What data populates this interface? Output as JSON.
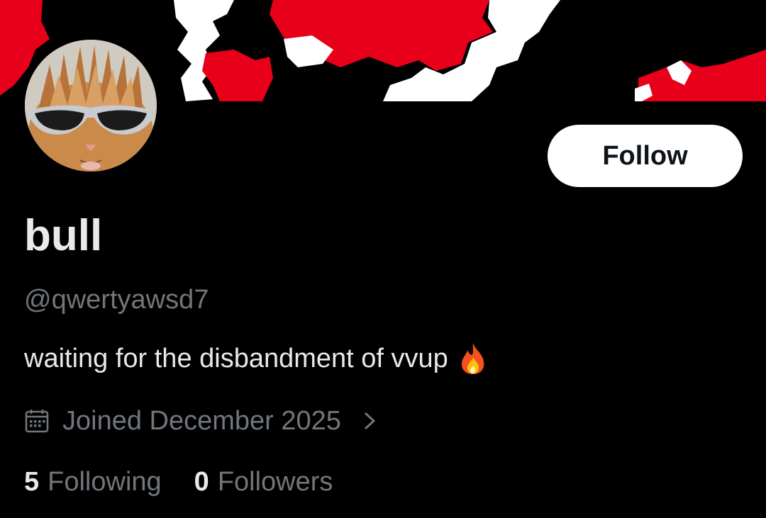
{
  "profile": {
    "display_name": "bull",
    "handle": "@qwertyawsd7",
    "bio": "waiting for the disbandment of vvup",
    "bio_emoji": "fire-emoji",
    "joined": "Joined December 2025"
  },
  "actions": {
    "follow_label": "Follow"
  },
  "stats": {
    "following_count": "5",
    "following_label": "Following",
    "followers_count": "0",
    "followers_label": "Followers"
  },
  "icons": {
    "calendar": "calendar-icon",
    "chevron": "chevron-right-icon"
  },
  "colors": {
    "background": "#000000",
    "primary_text": "#e7e9ea",
    "secondary_text": "#71767b",
    "button_bg": "#ffffff",
    "banner_red": "#e8001a",
    "banner_white": "#ffffff"
  }
}
